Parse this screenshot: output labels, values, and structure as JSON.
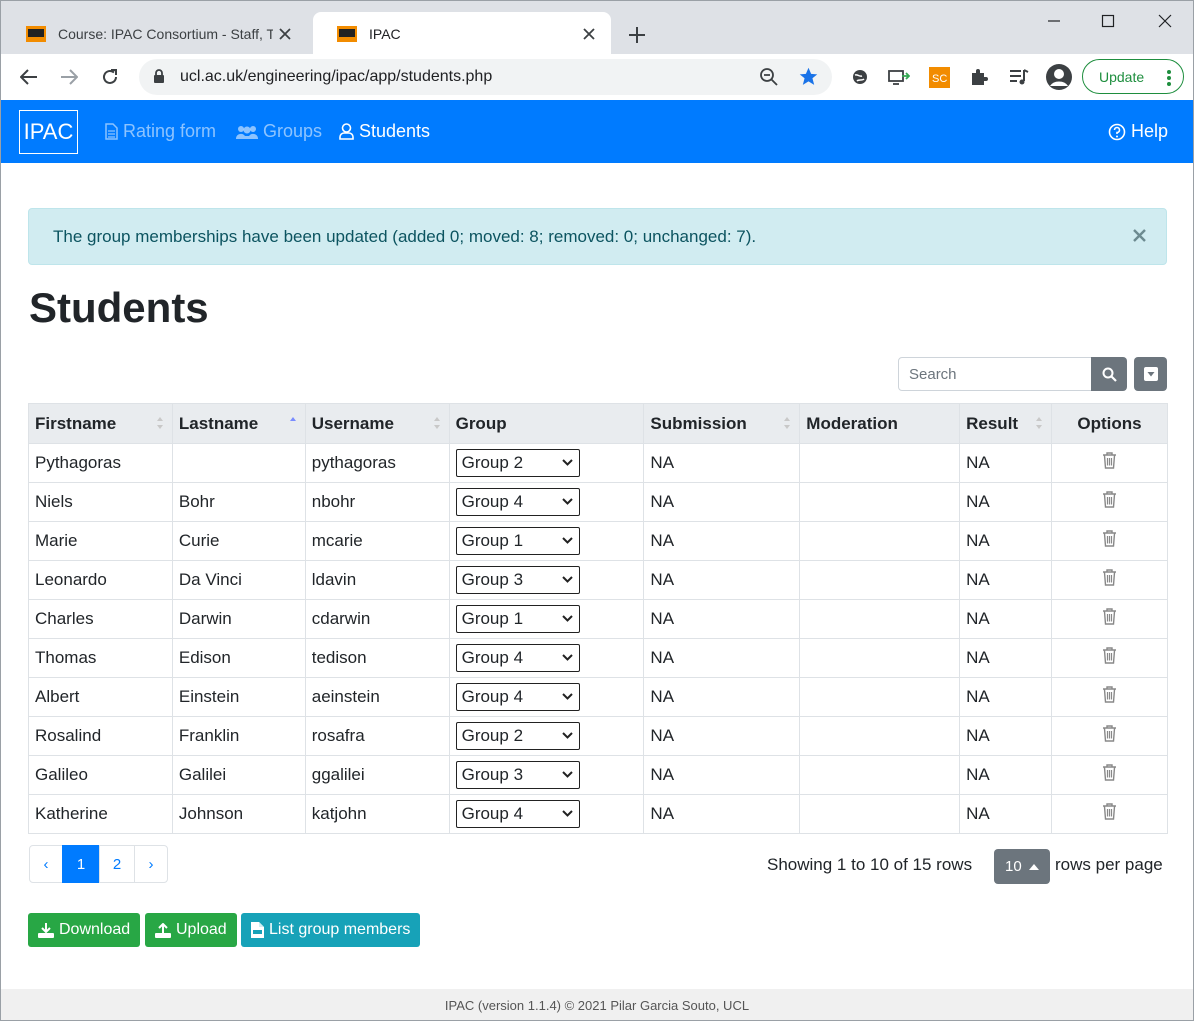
{
  "browser": {
    "tabs": [
      {
        "title": "Course: IPAC Consortium - Staff, T"
      },
      {
        "title": "IPAC"
      }
    ],
    "url": "ucl.ac.uk/engineering/ipac/app/students.php",
    "update_label": "Update"
  },
  "navbar": {
    "brand": "IPAC",
    "links": [
      {
        "label": "Rating form"
      },
      {
        "label": "Groups"
      },
      {
        "label": "Students"
      }
    ],
    "help": "Help"
  },
  "alert": {
    "message": "The group memberships have been updated (added 0; moved: 8; removed: 0; unchanged: 7).",
    "close": "×"
  },
  "page_title": "Students",
  "search": {
    "placeholder": "Search"
  },
  "table": {
    "headers": [
      "Firstname",
      "Lastname",
      "Username",
      "Group",
      "Submission",
      "Moderation",
      "Result",
      "Options"
    ],
    "rows": [
      {
        "first": "Pythagoras",
        "last": "",
        "user": "pythagoras",
        "group": "Group 2",
        "submission": "NA",
        "moderation": "",
        "result": "NA"
      },
      {
        "first": "Niels",
        "last": "Bohr",
        "user": "nbohr",
        "group": "Group 4",
        "submission": "NA",
        "moderation": "",
        "result": "NA"
      },
      {
        "first": "Marie",
        "last": "Curie",
        "user": "mcarie",
        "group": "Group 1",
        "submission": "NA",
        "moderation": "",
        "result": "NA"
      },
      {
        "first": "Leonardo",
        "last": "Da Vinci",
        "user": "ldavin",
        "group": "Group 3",
        "submission": "NA",
        "moderation": "",
        "result": "NA"
      },
      {
        "first": "Charles",
        "last": "Darwin",
        "user": "cdarwin",
        "group": "Group 1",
        "submission": "NA",
        "moderation": "",
        "result": "NA"
      },
      {
        "first": "Thomas",
        "last": "Edison",
        "user": "tedison",
        "group": "Group 4",
        "submission": "NA",
        "moderation": "",
        "result": "NA"
      },
      {
        "first": "Albert",
        "last": "Einstein",
        "user": "aeinstein",
        "group": "Group 4",
        "submission": "NA",
        "moderation": "",
        "result": "NA"
      },
      {
        "first": "Rosalind",
        "last": "Franklin",
        "user": "rosafra",
        "group": "Group 2",
        "submission": "NA",
        "moderation": "",
        "result": "NA"
      },
      {
        "first": "Galileo",
        "last": "Galilei",
        "user": "ggalilei",
        "group": "Group 3",
        "submission": "NA",
        "moderation": "",
        "result": "NA"
      },
      {
        "first": "Katherine",
        "last": "Johnson",
        "user": "katjohn",
        "group": "Group 4",
        "submission": "NA",
        "moderation": "",
        "result": "NA"
      }
    ]
  },
  "pagination": {
    "prev": "‹",
    "pages": [
      "1",
      "2"
    ],
    "next": "›",
    "info": "Showing 1 to 10 of 15 rows",
    "page_size": "10",
    "rows_per_page": "rows per page"
  },
  "buttons": {
    "download": "Download",
    "upload": "Upload",
    "list_members": "List group members"
  },
  "footer": "IPAC (version 1.1.4) © 2021 Pilar Garcia Souto, UCL",
  "colors": {
    "primary": "#007bff",
    "success": "#28a745",
    "info": "#17a2b8",
    "secondary": "#6c757d",
    "alert_bg": "#d1ecf1"
  }
}
